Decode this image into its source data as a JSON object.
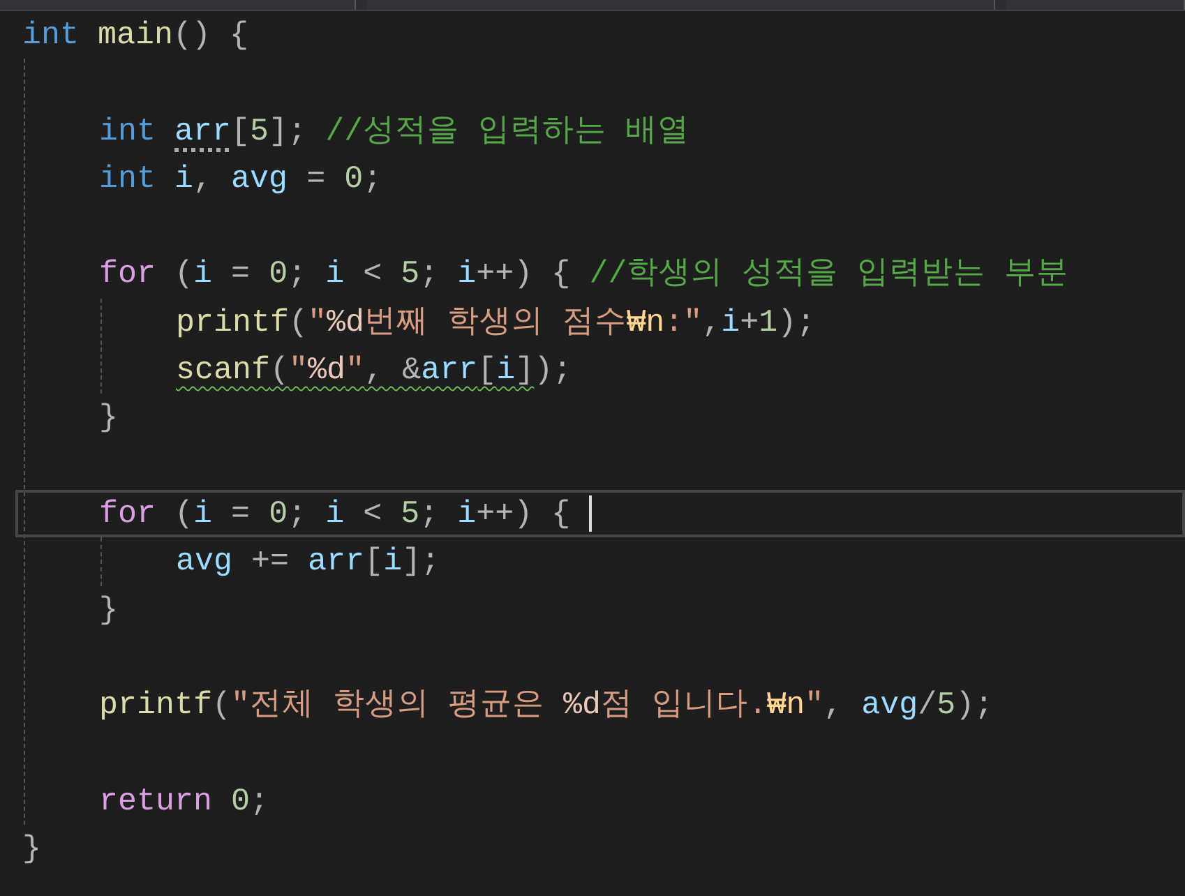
{
  "editor": {
    "lines": [
      {
        "kind": "code",
        "current": false,
        "tokens": [
          {
            "kind": "keyword",
            "text": "int "
          },
          {
            "kind": "func",
            "text": "main"
          },
          {
            "kind": "punct",
            "text": "() {"
          }
        ],
        "children": [
          {
            "kind": "blank"
          },
          {
            "kind": "code",
            "current": false,
            "tokens": [
              {
                "kind": "keyword",
                "text": "int "
              },
              {
                "kind": "var",
                "text": "arr",
                "hint": true
              },
              {
                "kind": "punct",
                "text": "["
              },
              {
                "kind": "number",
                "text": "5"
              },
              {
                "kind": "punct",
                "text": "]; "
              },
              {
                "kind": "comment",
                "text": "//성적을 입력하는 배열"
              }
            ]
          },
          {
            "kind": "code",
            "current": false,
            "tokens": [
              {
                "kind": "keyword",
                "text": "int "
              },
              {
                "kind": "var",
                "text": "i"
              },
              {
                "kind": "punct",
                "text": ", "
              },
              {
                "kind": "var",
                "text": "avg"
              },
              {
                "kind": "punct",
                "text": " = "
              },
              {
                "kind": "number",
                "text": "0"
              },
              {
                "kind": "punct",
                "text": ";"
              }
            ]
          },
          {
            "kind": "blank"
          },
          {
            "kind": "code",
            "current": false,
            "tokens": [
              {
                "kind": "control",
                "text": "for"
              },
              {
                "kind": "punct",
                "text": " ("
              },
              {
                "kind": "var",
                "text": "i"
              },
              {
                "kind": "punct",
                "text": " = "
              },
              {
                "kind": "number",
                "text": "0"
              },
              {
                "kind": "punct",
                "text": "; "
              },
              {
                "kind": "var",
                "text": "i"
              },
              {
                "kind": "punct",
                "text": " < "
              },
              {
                "kind": "number",
                "text": "5"
              },
              {
                "kind": "punct",
                "text": "; "
              },
              {
                "kind": "var",
                "text": "i"
              },
              {
                "kind": "punct",
                "text": "++) { "
              },
              {
                "kind": "comment",
                "text": "//학생의 성적을 입력받는 부분"
              }
            ],
            "children": [
              {
                "kind": "code",
                "current": false,
                "tokens": [
                  {
                    "kind": "func",
                    "text": "printf"
                  },
                  {
                    "kind": "punct",
                    "text": "("
                  },
                  {
                    "kind": "string",
                    "text": "\""
                  },
                  {
                    "kind": "format",
                    "text": "%d"
                  },
                  {
                    "kind": "string",
                    "text": "번째 학생의 점수"
                  },
                  {
                    "kind": "escape",
                    "text": "₩n"
                  },
                  {
                    "kind": "string",
                    "text": ":\""
                  },
                  {
                    "kind": "punct",
                    "text": ","
                  },
                  {
                    "kind": "var",
                    "text": "i"
                  },
                  {
                    "kind": "punct",
                    "text": "+"
                  },
                  {
                    "kind": "number",
                    "text": "1"
                  },
                  {
                    "kind": "punct",
                    "text": ");"
                  }
                ]
              },
              {
                "kind": "code",
                "current": false,
                "tokens": [
                  {
                    "kind": "func",
                    "text": "scanf",
                    "squiggle": true
                  },
                  {
                    "kind": "punct",
                    "text": "(",
                    "squiggle": true
                  },
                  {
                    "kind": "string",
                    "text": "\"",
                    "squiggle": true
                  },
                  {
                    "kind": "format",
                    "text": "%d",
                    "squiggle": true
                  },
                  {
                    "kind": "string",
                    "text": "\"",
                    "squiggle": true
                  },
                  {
                    "kind": "punct",
                    "text": ", &",
                    "squiggle": true
                  },
                  {
                    "kind": "var",
                    "text": "arr",
                    "squiggle": true
                  },
                  {
                    "kind": "punct",
                    "text": "[",
                    "squiggle": true
                  },
                  {
                    "kind": "var",
                    "text": "i",
                    "squiggle": true
                  },
                  {
                    "kind": "punct",
                    "text": "]",
                    "squiggle": true
                  },
                  {
                    "kind": "punct",
                    "text": ");"
                  }
                ]
              }
            ]
          },
          {
            "kind": "code",
            "current": false,
            "tokens": [
              {
                "kind": "punct",
                "text": "}"
              }
            ]
          },
          {
            "kind": "blank"
          },
          {
            "kind": "code",
            "current": true,
            "tokens": [
              {
                "kind": "control",
                "text": "for"
              },
              {
                "kind": "punct",
                "text": " ("
              },
              {
                "kind": "var",
                "text": "i"
              },
              {
                "kind": "punct",
                "text": " = "
              },
              {
                "kind": "number",
                "text": "0"
              },
              {
                "kind": "punct",
                "text": "; "
              },
              {
                "kind": "var",
                "text": "i"
              },
              {
                "kind": "punct",
                "text": " < "
              },
              {
                "kind": "number",
                "text": "5"
              },
              {
                "kind": "punct",
                "text": "; "
              },
              {
                "kind": "var",
                "text": "i"
              },
              {
                "kind": "punct",
                "text": "++) {"
              }
            ],
            "children": [
              {
                "kind": "code",
                "current": false,
                "tokens": [
                  {
                    "kind": "var",
                    "text": "avg"
                  },
                  {
                    "kind": "punct",
                    "text": " += "
                  },
                  {
                    "kind": "var",
                    "text": "arr"
                  },
                  {
                    "kind": "punct",
                    "text": "["
                  },
                  {
                    "kind": "var",
                    "text": "i"
                  },
                  {
                    "kind": "punct",
                    "text": "];"
                  }
                ]
              }
            ]
          },
          {
            "kind": "code",
            "current": false,
            "tokens": [
              {
                "kind": "punct",
                "text": "}"
              }
            ]
          },
          {
            "kind": "blank"
          },
          {
            "kind": "code",
            "current": false,
            "tokens": [
              {
                "kind": "func",
                "text": "printf"
              },
              {
                "kind": "punct",
                "text": "("
              },
              {
                "kind": "string",
                "text": "\"전체 학생의 평균은 "
              },
              {
                "kind": "format",
                "text": "%d"
              },
              {
                "kind": "string",
                "text": "점 입니다."
              },
              {
                "kind": "escape",
                "text": "₩n"
              },
              {
                "kind": "string",
                "text": "\""
              },
              {
                "kind": "punct",
                "text": ", "
              },
              {
                "kind": "var",
                "text": "avg"
              },
              {
                "kind": "punct",
                "text": "/"
              },
              {
                "kind": "number",
                "text": "5"
              },
              {
                "kind": "punct",
                "text": ");"
              }
            ]
          },
          {
            "kind": "blank"
          },
          {
            "kind": "code",
            "current": false,
            "tokens": [
              {
                "kind": "control",
                "text": "return "
              },
              {
                "kind": "number",
                "text": "0"
              },
              {
                "kind": "punct",
                "text": ";"
              }
            ]
          }
        ]
      },
      {
        "kind": "code",
        "current": false,
        "tokens": [
          {
            "kind": "punct",
            "text": "}"
          }
        ]
      }
    ]
  }
}
